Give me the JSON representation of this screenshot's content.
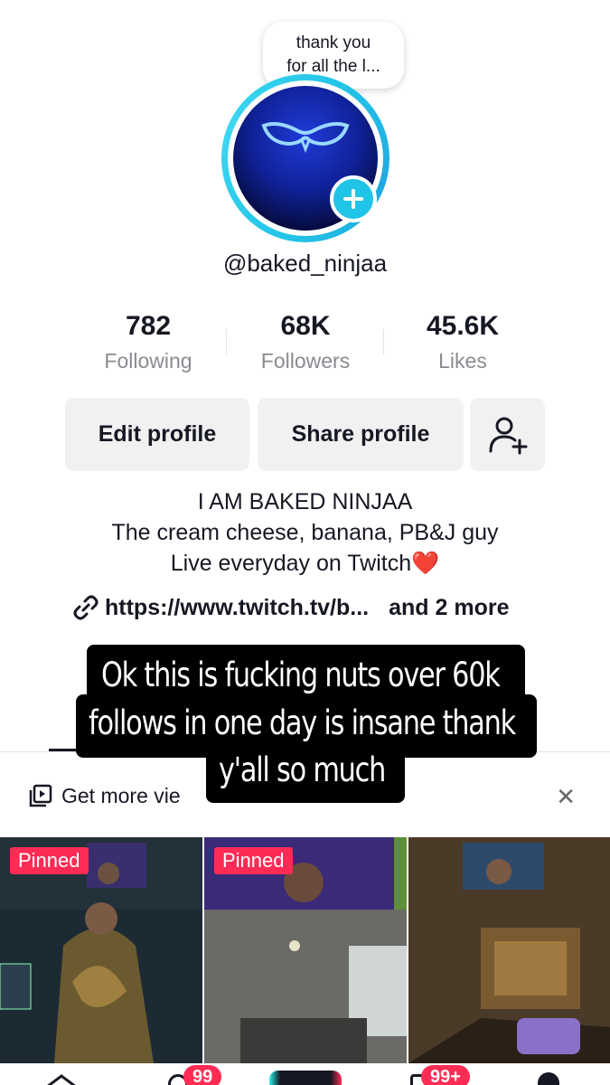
{
  "profile": {
    "speech_bubble": "thank you\nfor all the l...",
    "speech_line1": "thank you",
    "speech_line2": "for all the l...",
    "username": "@baked_ninjaa"
  },
  "stats": [
    {
      "value": "782",
      "label": "Following"
    },
    {
      "value": "68K",
      "label": "Followers"
    },
    {
      "value": "45.6K",
      "label": "Likes"
    }
  ],
  "buttons": {
    "edit": "Edit profile",
    "share": "Share profile"
  },
  "bio": {
    "line1": "I AM BAKED NINJAA",
    "line2": "The cream cheese, banana, PB&J guy",
    "line3": "Live everyday on Twitch",
    "heart": "❤️"
  },
  "links": {
    "url": "https://www.twitch.tv/b...",
    "more": "and 2 more"
  },
  "promo": {
    "text": "Get more views with playlists",
    "visible_text": "Get more vie"
  },
  "caption": {
    "line1": "Ok this is fucking nuts over 60k",
    "line2": "follows in one day is insane thank",
    "line3": "y'all so much"
  },
  "videos": [
    {
      "badge": "Pinned"
    },
    {
      "badge": "Pinned"
    },
    {
      "badge": ""
    }
  ],
  "nav": {
    "inbox_badge_1": "99",
    "inbox_badge_2": "99+"
  },
  "colors": {
    "accent": "#fe2c55",
    "ring": "#25c6e8",
    "button_bg": "#f1f1f2",
    "muted": "#8a8b91"
  }
}
